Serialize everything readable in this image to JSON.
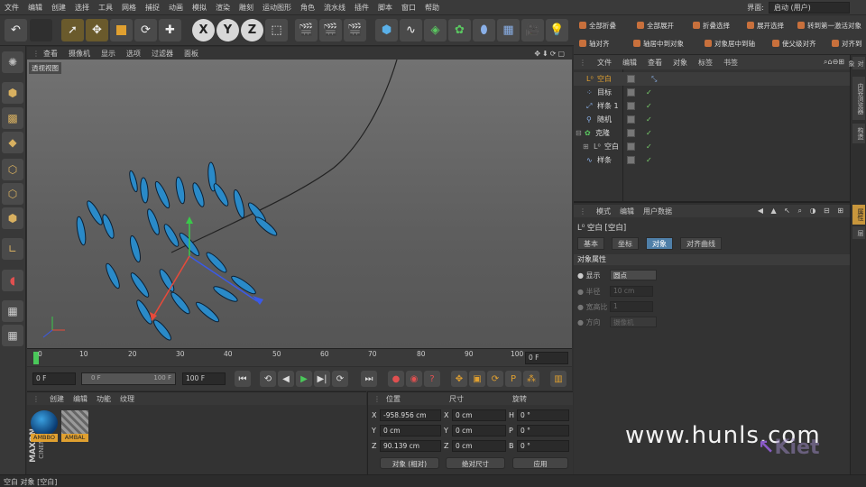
{
  "menu": [
    "文件",
    "编辑",
    "创建",
    "选择",
    "工具",
    "网格",
    "捕捉",
    "动画",
    "模拟",
    "渲染",
    "雕刻",
    "运动图形",
    "角色",
    "流水线",
    "插件",
    "脚本",
    "窗口",
    "帮助"
  ],
  "layout": {
    "label": "界面:",
    "value": "启动 (用户)"
  },
  "toolbar": {
    "axis_x": "X",
    "axis_y": "Y",
    "axis_z": "Z"
  },
  "right_toolbar": [
    "全部折叠",
    "全部展开",
    "折叠选择",
    "展开选择",
    "转到第一激活对象",
    "轴对齐",
    "轴居中到对象",
    "对象居中到轴",
    "使父级对齐",
    "对齐到"
  ],
  "viewport": {
    "menu": [
      "查看",
      "摄像机",
      "显示",
      "选项",
      "过滤器",
      "面板"
    ],
    "label": "透视视图"
  },
  "timeline": {
    "ticks": [
      "0",
      "10",
      "20",
      "30",
      "40",
      "50",
      "60",
      "70",
      "80",
      "90",
      "100"
    ],
    "end_frame": "0 F"
  },
  "playback": {
    "current": "0 F",
    "range_start": "0 F",
    "range_end": "100 F",
    "max": "100 F"
  },
  "material_manager": {
    "menu": [
      "创建",
      "编辑",
      "功能",
      "纹理"
    ],
    "materials": [
      "AMBBO",
      "AMBAL"
    ],
    "brand": "MAXON",
    "brand_sub": "CINEMA 4D"
  },
  "coordinates": {
    "headers": [
      "位置",
      "尺寸",
      "旋转"
    ],
    "rows": [
      {
        "axis": "X",
        "pos": "-958.956 cm",
        "size_axis": "X",
        "size": "0 cm",
        "rot_axis": "H",
        "rot": "0 °"
      },
      {
        "axis": "Y",
        "pos": "0 cm",
        "size_axis": "Y",
        "size": "0 cm",
        "rot_axis": "P",
        "rot": "0 °"
      },
      {
        "axis": "Z",
        "pos": "90.139 cm",
        "size_axis": "Z",
        "size": "0 cm",
        "rot_axis": "B",
        "rot": "0 °"
      }
    ],
    "mode1": "对象 (相对)",
    "mode2": "绝对尺寸",
    "apply": "应用"
  },
  "object_manager": {
    "menu": [
      "文件",
      "编辑",
      "查看",
      "对象",
      "标签",
      "书签"
    ],
    "objects": [
      {
        "name": "空白",
        "indent": 0,
        "selected": true
      },
      {
        "name": "目标",
        "indent": 1,
        "selected": false
      },
      {
        "name": "样条 1",
        "indent": 1,
        "selected": false
      },
      {
        "name": "随机",
        "indent": 1,
        "selected": false
      },
      {
        "name": "克隆",
        "indent": 0,
        "selected": false
      },
      {
        "name": "空白",
        "indent": 1,
        "selected": false
      },
      {
        "name": "样条",
        "indent": 0,
        "selected": false
      }
    ]
  },
  "attribute_manager": {
    "menu": [
      "模式",
      "编辑",
      "用户数据"
    ],
    "title": "空白 [空白]",
    "tabs": [
      "基本",
      "坐标",
      "对象",
      "对齐曲线"
    ],
    "active_tab": "对象",
    "section": "对象属性",
    "props": [
      {
        "label": "显示",
        "value": "圆点"
      },
      {
        "label": "半径",
        "value": "10 cm"
      },
      {
        "label": "宽高比",
        "value": "1"
      },
      {
        "label": "方向",
        "value": "摄像机"
      }
    ]
  },
  "side_tabs": [
    "对象",
    "内容浏览器",
    "构造",
    "属性",
    "层"
  ],
  "status": "空白 对象 [空白]",
  "watermark": "www.hunls.com",
  "logo_text": "Kiet"
}
